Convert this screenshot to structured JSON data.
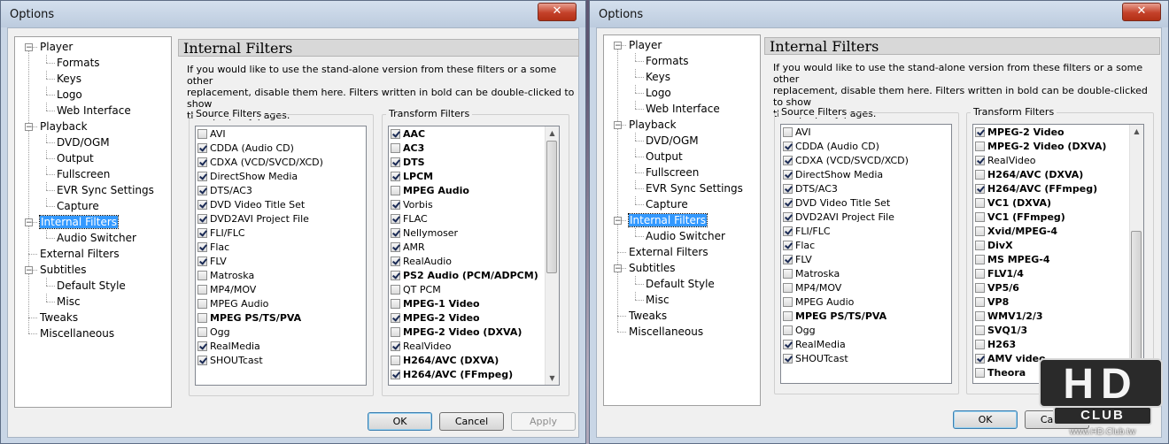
{
  "window_title": "Options",
  "close_glyph": "✕",
  "tree": [
    {
      "label": "Player",
      "level": 0,
      "expander": "−"
    },
    {
      "label": "Formats",
      "level": 1
    },
    {
      "label": "Keys",
      "level": 1
    },
    {
      "label": "Logo",
      "level": 1
    },
    {
      "label": "Web Interface",
      "level": 1
    },
    {
      "label": "Playback",
      "level": 0,
      "expander": "−"
    },
    {
      "label": "DVD/OGM",
      "level": 1
    },
    {
      "label": "Output",
      "level": 1
    },
    {
      "label": "Fullscreen",
      "level": 1
    },
    {
      "label": "EVR Sync Settings",
      "level": 1
    },
    {
      "label": "Capture",
      "level": 1
    },
    {
      "label": "Internal Filters",
      "level": 0,
      "expander": "−",
      "selected": true
    },
    {
      "label": "Audio Switcher",
      "level": 1
    },
    {
      "label": "External Filters",
      "level": 0
    },
    {
      "label": "Subtitles",
      "level": 0,
      "expander": "−"
    },
    {
      "label": "Default Style",
      "level": 1
    },
    {
      "label": "Misc",
      "level": 1
    },
    {
      "label": "Tweaks",
      "level": 0
    },
    {
      "label": "Miscellaneous",
      "level": 0
    }
  ],
  "page_header": "Internal Filters",
  "description_lines": [
    "If you would like to use the stand-alone version from these filters or a some other",
    "replacement, disable them here. Filters written in bold can be double-clicked to show",
    "their property pages."
  ],
  "source_filters_label": "Source Filters",
  "transform_filters_label": "Transform Filters",
  "source_filters": [
    {
      "label": "AVI",
      "checked": false,
      "bold": false
    },
    {
      "label": "CDDA (Audio CD)",
      "checked": true,
      "bold": false
    },
    {
      "label": "CDXA (VCD/SVCD/XCD)",
      "checked": true,
      "bold": false
    },
    {
      "label": "DirectShow Media",
      "checked": true,
      "bold": false
    },
    {
      "label": "DTS/AC3",
      "checked": true,
      "bold": false
    },
    {
      "label": "DVD Video Title Set",
      "checked": true,
      "bold": false
    },
    {
      "label": "DVD2AVI Project File",
      "checked": true,
      "bold": false
    },
    {
      "label": "FLI/FLC",
      "checked": true,
      "bold": false
    },
    {
      "label": "Flac",
      "checked": true,
      "bold": false
    },
    {
      "label": "FLV",
      "checked": true,
      "bold": false
    },
    {
      "label": "Matroska",
      "checked": false,
      "bold": false
    },
    {
      "label": "MP4/MOV",
      "checked": false,
      "bold": false
    },
    {
      "label": "MPEG Audio",
      "checked": false,
      "bold": false
    },
    {
      "label": "MPEG PS/TS/PVA",
      "checked": false,
      "bold": true
    },
    {
      "label": "Ogg",
      "checked": false,
      "bold": false
    },
    {
      "label": "RealMedia",
      "checked": true,
      "bold": false
    },
    {
      "label": "SHOUTcast",
      "checked": true,
      "bold": false
    }
  ],
  "transform_filters_left": [
    {
      "label": "AAC",
      "checked": true,
      "bold": true
    },
    {
      "label": "AC3",
      "checked": false,
      "bold": true
    },
    {
      "label": "DTS",
      "checked": true,
      "bold": true
    },
    {
      "label": "LPCM",
      "checked": true,
      "bold": true
    },
    {
      "label": "MPEG Audio",
      "checked": false,
      "bold": true
    },
    {
      "label": "Vorbis",
      "checked": true,
      "bold": false
    },
    {
      "label": "FLAC",
      "checked": true,
      "bold": false
    },
    {
      "label": "Nellymoser",
      "checked": true,
      "bold": false
    },
    {
      "label": "AMR",
      "checked": true,
      "bold": false
    },
    {
      "label": "RealAudio",
      "checked": true,
      "bold": false
    },
    {
      "label": "PS2 Audio (PCM/ADPCM)",
      "checked": true,
      "bold": true
    },
    {
      "label": "QT PCM",
      "checked": false,
      "bold": false
    },
    {
      "label": "MPEG-1 Video",
      "checked": false,
      "bold": true
    },
    {
      "label": "MPEG-2 Video",
      "checked": true,
      "bold": true
    },
    {
      "label": "MPEG-2 Video (DXVA)",
      "checked": false,
      "bold": true
    },
    {
      "label": "RealVideo",
      "checked": true,
      "bold": false
    },
    {
      "label": "H264/AVC (DXVA)",
      "checked": false,
      "bold": true
    },
    {
      "label": "H264/AVC (FFmpeg)",
      "checked": true,
      "bold": true
    }
  ],
  "transform_filters_right": [
    {
      "label": "MPEG-2 Video",
      "checked": true,
      "bold": true
    },
    {
      "label": "MPEG-2 Video (DXVA)",
      "checked": false,
      "bold": true
    },
    {
      "label": "RealVideo",
      "checked": true,
      "bold": false
    },
    {
      "label": "H264/AVC (DXVA)",
      "checked": false,
      "bold": true
    },
    {
      "label": "H264/AVC (FFmpeg)",
      "checked": true,
      "bold": true
    },
    {
      "label": "VC1 (DXVA)",
      "checked": false,
      "bold": true
    },
    {
      "label": "VC1 (FFmpeg)",
      "checked": false,
      "bold": true
    },
    {
      "label": "Xvid/MPEG-4",
      "checked": false,
      "bold": true
    },
    {
      "label": "DivX",
      "checked": false,
      "bold": true
    },
    {
      "label": "MS MPEG-4",
      "checked": false,
      "bold": true
    },
    {
      "label": "FLV1/4",
      "checked": false,
      "bold": true
    },
    {
      "label": "VP5/6",
      "checked": false,
      "bold": true
    },
    {
      "label": "VP8",
      "checked": false,
      "bold": true
    },
    {
      "label": "WMV1/2/3",
      "checked": false,
      "bold": true
    },
    {
      "label": "SVQ1/3",
      "checked": false,
      "bold": true
    },
    {
      "label": "H263",
      "checked": false,
      "bold": true
    },
    {
      "label": "AMV video",
      "checked": true,
      "bold": true
    },
    {
      "label": "Theora",
      "checked": false,
      "bold": true
    }
  ],
  "buttons": {
    "ok": "OK",
    "cancel": "Cancel",
    "apply": "Apply"
  },
  "watermark": {
    "line1": "HD",
    "line2": "CLUB",
    "url": "www.HD.Club.tw"
  },
  "scroll_arrows": {
    "up": "▲",
    "down": "▼"
  }
}
